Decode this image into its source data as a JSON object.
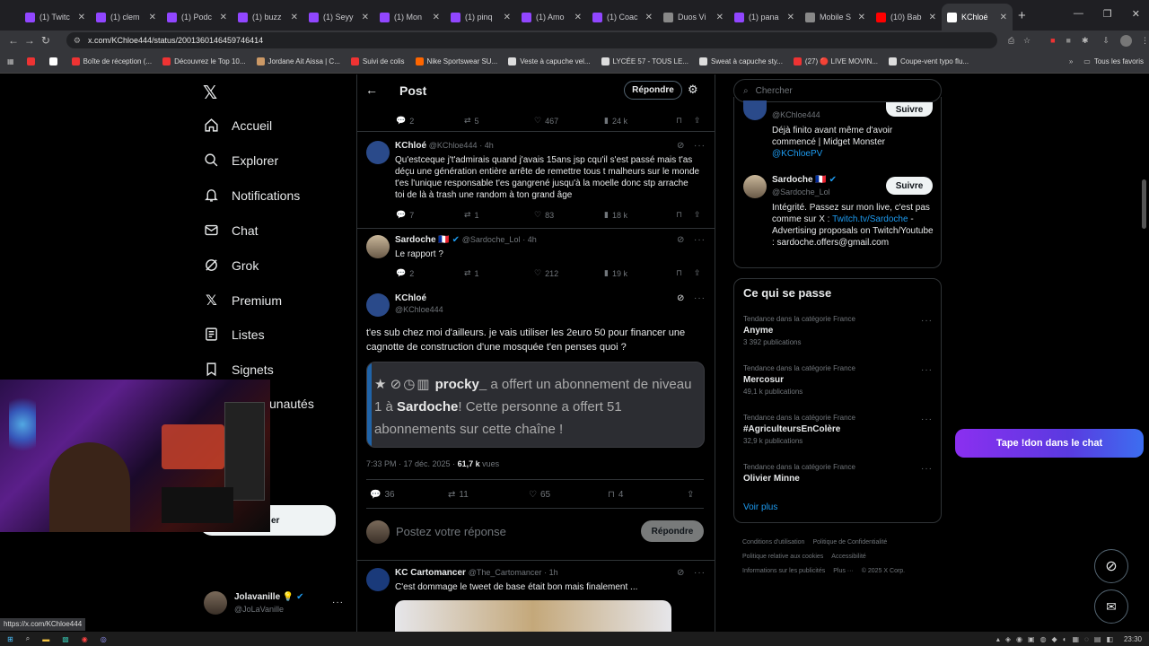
{
  "browser": {
    "tabs": [
      {
        "label": "(1) Twitc",
        "color": "#9146ff"
      },
      {
        "label": "(1) clem",
        "color": "#9146ff"
      },
      {
        "label": "(1) Podc",
        "color": "#9146ff"
      },
      {
        "label": "(1) buzz",
        "color": "#9146ff"
      },
      {
        "label": "(1) Seyy",
        "color": "#9146ff"
      },
      {
        "label": "(1) Mon",
        "color": "#9146ff"
      },
      {
        "label": "(1) pinq",
        "color": "#9146ff"
      },
      {
        "label": "(1) Amo",
        "color": "#9146ff"
      },
      {
        "label": "(1) Coac",
        "color": "#9146ff"
      },
      {
        "label": "Duos Vi",
        "color": "#888888"
      },
      {
        "label": "(1) pana",
        "color": "#9146ff"
      },
      {
        "label": "Mobile S",
        "color": "#888888"
      },
      {
        "label": "(10) Bab",
        "color": "#ff0000"
      },
      {
        "label": "KChloé",
        "color": "#ffffff"
      }
    ],
    "url": "x.com/KChloe444/status/2001360146459746414",
    "bookmarks": [
      "",
      "",
      "Boîte de réception (...",
      "Découvrez le Top 10...",
      "Jordane Ait Aissa | C...",
      "Suivi de colis",
      "Nike Sportswear SU...",
      "Veste à capuche vel...",
      "LYCÉE 57 - TOUS LE...",
      "Sweat à capuche sty...",
      "(27) 🔴 LIVE MOVIN...",
      "Coupe-vent typo flu..."
    ],
    "all_bookmarks": "Tous les favoris",
    "status_url": "https://x.com/KChloe444"
  },
  "nav": {
    "items": [
      "Accueil",
      "Explorer",
      "Notifications",
      "Chat",
      "Grok",
      "Premium",
      "Listes",
      "Signets",
      "unautés"
    ],
    "post_button": "er",
    "account_name": "Jolavanille",
    "account_handle": "@JoLaVanille"
  },
  "header": {
    "title": "Post",
    "reply_button": "Répondre"
  },
  "tweets": {
    "top_stats": {
      "replies": "2",
      "retweets": "5",
      "likes": "467",
      "views": "24 k"
    },
    "t1": {
      "name": "KChloé",
      "handle": "@KChloe444",
      "time": "· 4h",
      "text": "Qu'estceque j't'admirais quand j'avais 15ans jsp cqu'il s'est passé mais t'as déçu une génération entière arrête de remettre tous t malheurs sur le monde t'es l'unique responsable t'es gangrené jusqu'à la moelle donc stp arrache toi de là à trash une random à ton grand âge",
      "replies": "7",
      "retweets": "1",
      "likes": "83",
      "views": "18 k"
    },
    "t2": {
      "name": "Sardoche",
      "flag": "🇫🇷",
      "handle": "@Sardoche_Lol",
      "time": "· 4h",
      "text": "Le rapport ?",
      "replies": "2",
      "retweets": "1",
      "likes": "212",
      "views": "19 k"
    },
    "main": {
      "name": "KChloé",
      "handle": "@KChloe444",
      "text": "t'es sub chez moi d'ailleurs. je vais utiliser les 2euro 50 pour financer une cagnotte de construction d'une mosquée t'en penses quoi ?",
      "embed_user": "procky_",
      "embed_text1": " a offert un abonnement de niveau 1 à ",
      "embed_target": "Sardoche",
      "embed_text2": "! Cette personne a offert 51 abonnements sur cette chaîne !",
      "timestamp": "7:33 PM · 17 déc. 2025 · ",
      "views_count": "61,7 k",
      "views_label": " vues",
      "replies": "36",
      "retweets": "11",
      "likes": "65",
      "bookmarks": "4"
    },
    "reply_placeholder": "Postez votre réponse",
    "reply_button": "Répondre",
    "t3": {
      "name": "KC Cartomancer",
      "handle": "@The_Cartomancer",
      "time": "· 1h",
      "text": "C'est dommage le tweet de base était bon mais finalement ..."
    }
  },
  "sidebar": {
    "search_placeholder": "Chercher",
    "who": [
      {
        "handle": "@KChloe444",
        "bio": "Déjà finito avant même d'avoir commencé | Midget Monster",
        "bio_link": "@KChloePV",
        "follow": "Suivre"
      },
      {
        "name": "Sardoche",
        "flag": "🇫🇷",
        "handle": "@Sardoche_Lol",
        "bio1": "Intégrité. Passez sur mon live, c'est pas comme sur X : ",
        "bio_link": "Twitch.tv/Sardoche",
        "bio2": " - Advertising proposals on Twitch/Youtube : sardoche.offers@gmail.com",
        "follow": "Suivre"
      }
    ],
    "trends_title": "Ce qui se passe",
    "trends": [
      {
        "category": "Tendance dans la catégorie France",
        "name": "Anyme",
        "count": "3 392 publications"
      },
      {
        "category": "Tendance dans la catégorie France",
        "name": "Mercosur",
        "count": "49,1 k publications"
      },
      {
        "category": "Tendance dans la catégorie France",
        "name": "#AgriculteursEnColère",
        "count": "32,9 k publications"
      },
      {
        "category": "Tendance dans la catégorie France",
        "name": "Olivier Minne",
        "count": ""
      }
    ],
    "see_more": "Voir plus",
    "footer": [
      "Conditions d'utilisation",
      "Politique de Confidentialité",
      "Politique relative aux cookies",
      "Accessibilité",
      "Informations sur les publicités",
      "Plus ···",
      "© 2025 X Corp."
    ]
  },
  "overlay": {
    "don_banner": "Tape !don dans le chat"
  },
  "taskbar": {
    "clock": "23:30"
  }
}
